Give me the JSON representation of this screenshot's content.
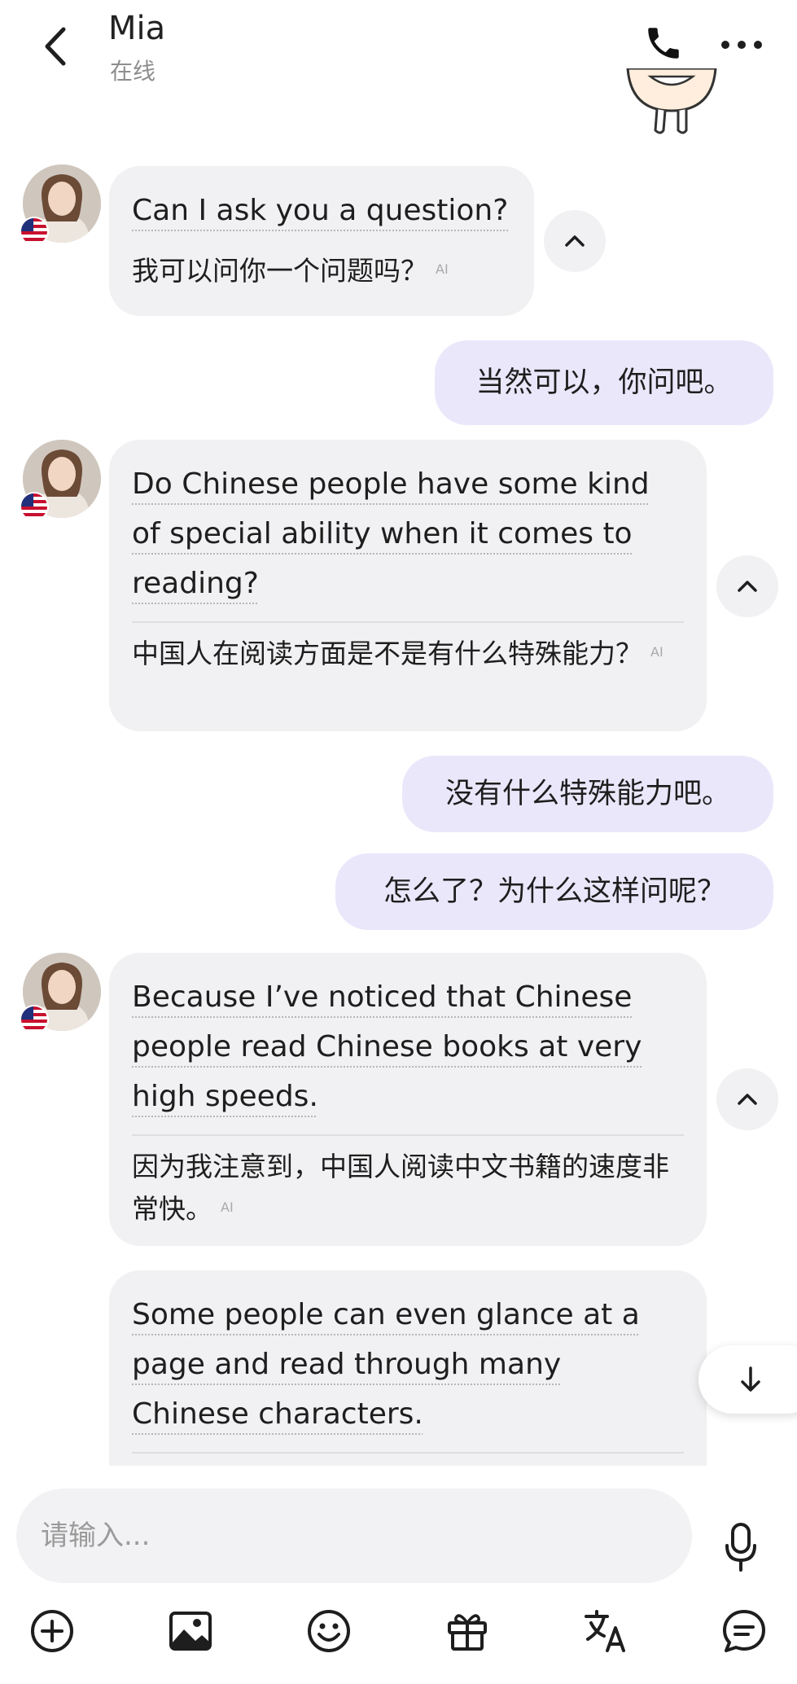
{
  "header": {
    "name": "Mia",
    "status": "在线",
    "icons": [
      "back-icon",
      "phone-icon",
      "more-icon"
    ]
  },
  "messages": [
    {
      "from": "Mia",
      "text": "Can I ask you a question?",
      "translation": "我可以问你一个问题吗？",
      "translation_tag": "AI"
    },
    {
      "from": "me",
      "text": "当然可以，你问吧。"
    },
    {
      "from": "Mia",
      "text": "Do Chinese people have some kind of special ability when it comes to reading?",
      "translation": "中国人在阅读方面是不是有什么特殊能力？",
      "translation_tag": "AI"
    },
    {
      "from": "me",
      "text": "没有什么特殊能力吧。"
    },
    {
      "from": "me",
      "text": "怎么了？为什么这样问呢？"
    },
    {
      "from": "Mia",
      "text": "Because I’ve noticed that Chinese people read Chinese books at very high speeds.",
      "translation": "因为我注意到，中国人阅读中文书籍的速度非常快。",
      "translation_tag": "AI"
    },
    {
      "from": "Mia",
      "text": "Some people can even glance at a page and read through many Chinese characters."
    }
  ],
  "composer": {
    "placeholder": "请输入...",
    "toolbar_icons": [
      "add-icon",
      "image-icon",
      "emoji-icon",
      "gift-icon",
      "translate-icon",
      "message-icon"
    ]
  },
  "colors": {
    "incoming_bubble": "#f1f1f3",
    "outgoing_bubble": "#ebe7fb",
    "underline_accent": "#2bb6a0"
  }
}
